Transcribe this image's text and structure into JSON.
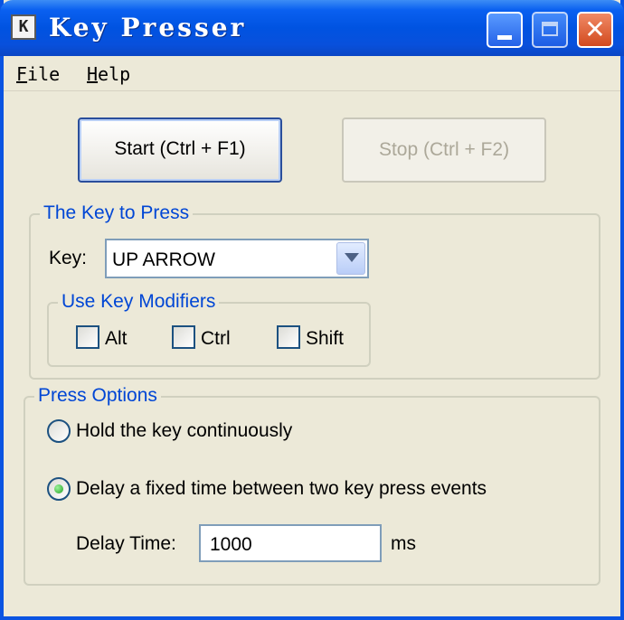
{
  "window": {
    "title": "Key Presser",
    "app_icon_letter": "K",
    "controls": {
      "minimize": "minimize-icon",
      "maximize": "maximize-icon",
      "close": "close-icon",
      "close_glyph": "✕"
    }
  },
  "menu": {
    "file": {
      "accel": "F",
      "rest": "ile"
    },
    "help": {
      "accel": "H",
      "rest": "elp"
    }
  },
  "buttons": {
    "start": "Start (Ctrl + F1)",
    "stop": "Stop (Ctrl + F2)"
  },
  "key_group": {
    "legend": "The Key to Press",
    "key_label": "Key:",
    "key_value": "UP ARROW"
  },
  "modifiers": {
    "legend": "Use Key Modifiers",
    "alt": {
      "label": "Alt",
      "checked": false
    },
    "ctrl": {
      "label": "Ctrl",
      "checked": false
    },
    "shift": {
      "label": "Shift",
      "checked": false
    }
  },
  "press_options": {
    "legend": "Press Options",
    "hold": {
      "label": "Hold the key continuously",
      "selected": false
    },
    "delay": {
      "label": "Delay a fixed time between two key press events",
      "selected": true
    },
    "delay_label": "Delay Time:",
    "delay_value": "1000",
    "delay_unit": "ms"
  },
  "colors": {
    "titlebar": "#0053e1",
    "legend_text": "#0046d5",
    "window_bg": "#ece9d8",
    "disabled_text": "#aca899"
  }
}
